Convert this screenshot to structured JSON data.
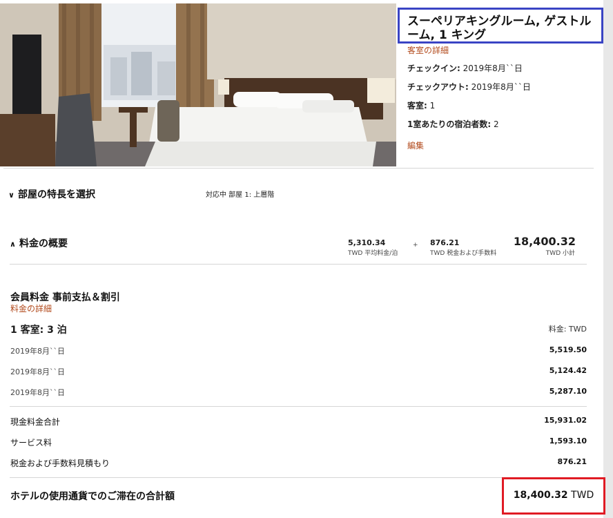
{
  "room": {
    "title": "スーペリアキングルーム, ゲストルーム, 1 キング",
    "detail_link": "客室の詳細",
    "checkin_label": "チェックイン:",
    "checkin_value": "2019年8月``日",
    "checkout_label": "チェックアウト:",
    "checkout_value": "2019年8月``日",
    "guests_label": "客室:",
    "guests_value": "1",
    "per_room_label": "1室あたりの宿泊者数:",
    "per_room_value": "2",
    "edit_link": "編集"
  },
  "features": {
    "heading": "部屋の特長を選択",
    "supported_label": "対応中 部屋 1:",
    "supported_value": "上層階"
  },
  "summary": {
    "heading": "料金の概要",
    "avg_value": "5,310.34",
    "avg_caption": "TWD 平均料金/泊",
    "plus": "+",
    "tax_value": "876.21",
    "tax_caption": "TWD 税金および手数料",
    "subtotal_value": "18,400.32",
    "subtotal_caption": "TWD 小計"
  },
  "rate": {
    "plan_name": "会員料金 事前支払＆割引",
    "detail_link": "料金の詳細",
    "rooms_nights": "1 客室: 3 泊",
    "currency_label": "料金: TWD",
    "nights": [
      {
        "date": "2019年8月``日",
        "amount": "5,519.50"
      },
      {
        "date": "2019年8月``日",
        "amount": "5,124.42"
      },
      {
        "date": "2019年8月``日",
        "amount": "5,287.10"
      }
    ],
    "cash_total_label": "現金料金合計",
    "cash_total_value": "15,931.02",
    "service_label": "サービス料",
    "service_value": "1,593.10",
    "tax_label": "税金および手数料見積もり",
    "tax_value": "876.21"
  },
  "total": {
    "label": "ホテルの使用通貨でのご滞在の合計額",
    "amount": "18,400.32",
    "currency": "TWD"
  },
  "icons": {
    "chevron_down": "chevron-down-icon",
    "chevron_up": "chevron-up-icon"
  },
  "colors": {
    "link": "#b24a1c",
    "title_highlight": "#3a44c4",
    "total_highlight": "#e01b24"
  }
}
